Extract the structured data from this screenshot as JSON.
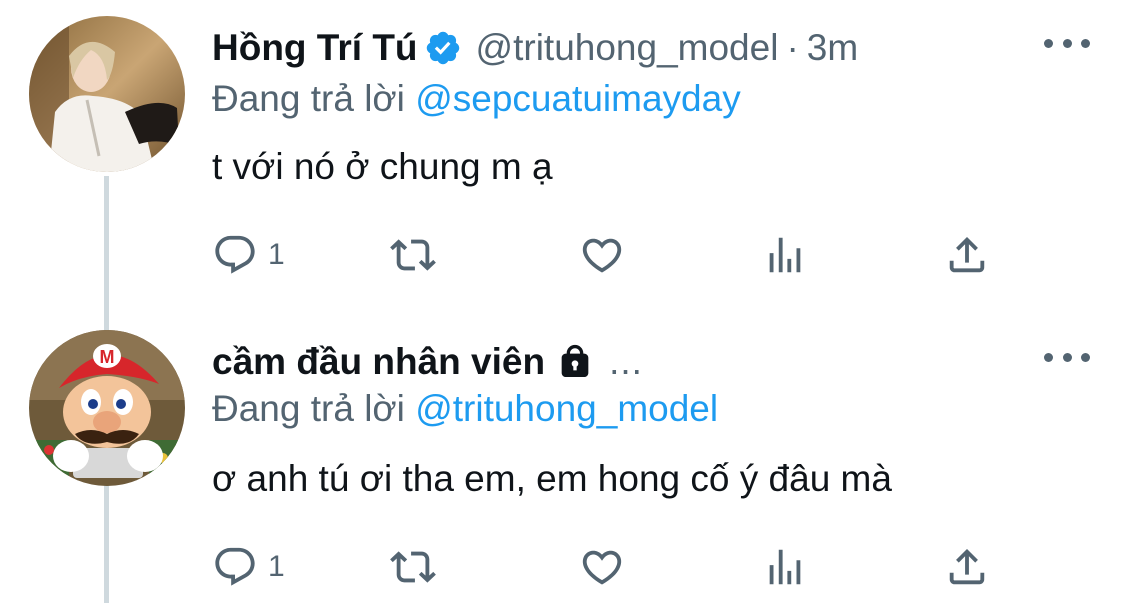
{
  "colors": {
    "text": "#0f1419",
    "secondary": "#536471",
    "link": "#1d9bf0",
    "verified": "#1d9bf0",
    "thread_line": "#cfd9de"
  },
  "tweets": [
    {
      "display_name": "Hồng Trí Tú",
      "verified": true,
      "handle": "@trituhong_model",
      "separator": "·",
      "time": "3m",
      "replying_prefix": "Đang trả lời",
      "replying_to": "@sepcuatuimayday",
      "text": "t với nó ở chung m ạ",
      "reply_count": "1",
      "icons": [
        "reply-icon",
        "retweet-icon",
        "like-icon",
        "views-icon",
        "share-icon",
        "more-icon",
        "verified-icon"
      ]
    },
    {
      "display_name": "cầm đầu nhân viên",
      "protected": true,
      "truncation": "...",
      "replying_prefix": "Đang trả lời",
      "replying_to": "@trituhong_model",
      "text": "ơ anh tú ơi tha em, em hong cố ý đâu mà",
      "reply_count": "1",
      "icons": [
        "reply-icon",
        "retweet-icon",
        "like-icon",
        "views-icon",
        "share-icon",
        "more-icon",
        "lock-icon"
      ]
    }
  ]
}
